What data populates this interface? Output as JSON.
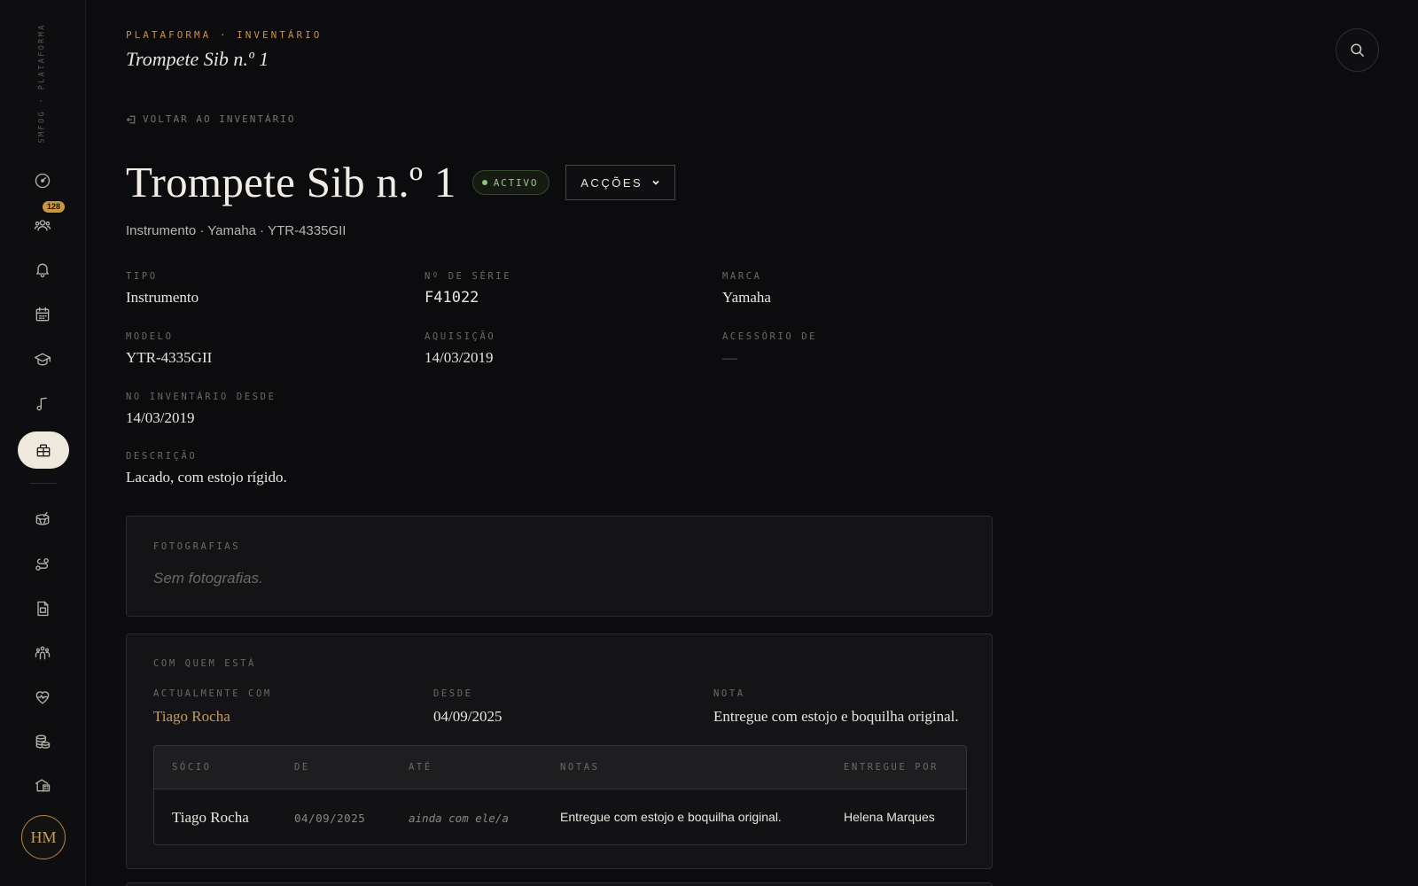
{
  "sidebar": {
    "brand": "SMFOG · PLATAFORMA",
    "nav": [
      {
        "name": "dashboard-icon"
      },
      {
        "name": "members-icon",
        "badge": "128"
      },
      {
        "name": "bell-icon"
      },
      {
        "name": "calendar-icon"
      },
      {
        "name": "graduation-cap-icon"
      },
      {
        "name": "music-note-icon"
      },
      {
        "name": "inventory-icon",
        "active": true
      },
      {
        "name": "drum-icon"
      },
      {
        "name": "route-icon"
      },
      {
        "name": "document-icon"
      },
      {
        "name": "group-icon"
      },
      {
        "name": "heart-pulse-icon"
      },
      {
        "name": "coins-icon"
      },
      {
        "name": "building-icon"
      }
    ],
    "avatar_initials": "HM"
  },
  "header": {
    "breadcrumb": "PLATAFORMA · INVENTÁRIO",
    "title": "Trompete Sib n.º 1"
  },
  "back_link": "VOLTAR AO INVENTÁRIO",
  "item": {
    "title": "Trompete Sib n.º 1",
    "status": "ACTIVO",
    "actions_label": "ACÇÕES",
    "subtitle": "Instrumento · Yamaha · YTR-4335GII"
  },
  "fields": {
    "tipo": {
      "label": "TIPO",
      "value": "Instrumento"
    },
    "serie": {
      "label": "Nº DE SÉRIE",
      "value": "F41022"
    },
    "marca": {
      "label": "MARCA",
      "value": "Yamaha"
    },
    "modelo": {
      "label": "MODELO",
      "value": "YTR-4335GII"
    },
    "aquisicao": {
      "label": "AQUISIÇÃO",
      "value": "14/03/2019"
    },
    "acessorio": {
      "label": "ACESSÓRIO DE",
      "value": "—"
    },
    "inventario": {
      "label": "NO INVENTÁRIO DESDE",
      "value": "14/03/2019"
    },
    "descricao": {
      "label": "DESCRIÇÃO",
      "value": "Lacado, com estojo rígido."
    }
  },
  "photos": {
    "label": "FOTOGRAFIAS",
    "empty": "Sem fotografias."
  },
  "holder": {
    "label": "COM QUEM ESTÁ",
    "current": {
      "label": "ACTUALMENTE COM",
      "value": "Tiago Rocha"
    },
    "since": {
      "label": "DESDE",
      "value": "04/09/2025"
    },
    "note": {
      "label": "NOTA",
      "value": "Entregue com estojo e boquilha original."
    },
    "table": {
      "headers": {
        "socio": "SÓCIO",
        "de": "DE",
        "ate": "ATÉ",
        "notas": "NOTAS",
        "entregue": "ENTREGUE POR"
      },
      "rows": [
        {
          "socio": "Tiago Rocha",
          "de": "04/09/2025",
          "ate": "ainda com ele/a",
          "notas": "Entregue com estojo e boquilha original.",
          "entregue": "Helena Marques"
        }
      ]
    }
  },
  "colors": {
    "accent": "#c4914a",
    "status_green": "#8fc27c",
    "background": "#0c0c0f"
  }
}
